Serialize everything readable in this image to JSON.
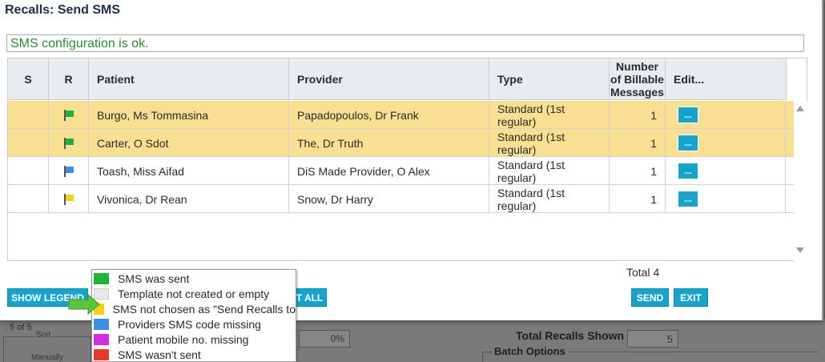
{
  "dialog": {
    "title": "Recalls: Send SMS",
    "status_message": "SMS configuration is ok.",
    "status_color": "#2d8a2d"
  },
  "grid": {
    "columns": {
      "s": "S",
      "r": "R",
      "patient": "Patient",
      "provider": "Provider",
      "type": "Type",
      "billable": [
        "Number",
        "of Billable",
        "Messages"
      ],
      "edit": "Edit..."
    },
    "rows": [
      {
        "flag": "green-flag",
        "flag_color": "#1fb437",
        "patient": "Burgo, Ms Tommasina",
        "provider": "Papadopoulos, Dr Frank",
        "type": [
          "Standard (1st",
          "regular)"
        ],
        "billable": "1",
        "edit": "...",
        "selected": true
      },
      {
        "flag": "green-flag",
        "flag_color": "#1fb437",
        "patient": "Carter, O Sdot",
        "provider": "The, Dr Truth",
        "type": [
          "Standard (1st",
          "regular)"
        ],
        "billable": "1",
        "edit": "...",
        "selected": true
      },
      {
        "flag": "blue-flag",
        "flag_color": "#3d8ee6",
        "patient": "Toash, Miss Aifad",
        "provider": "DiS Made Provider, O Alex",
        "type": [
          "Standard (1st",
          "regular)"
        ],
        "billable": "1",
        "edit": "...",
        "selected": false
      },
      {
        "flag": "yellow-flag",
        "flag_color": "#f2d21a",
        "patient": "Vivonica, Dr Rean",
        "provider": "Snow, Dr Harry",
        "type": [
          "Standard (1st",
          "regular)"
        ],
        "billable": "1",
        "edit": "...",
        "selected": false
      }
    ],
    "selected_row_color": "#f8df92"
  },
  "total": "Total 4",
  "buttons": {
    "show_legend": "SHOW LEGEND",
    "print_all": "T ALL",
    "send": "SEND",
    "exit": "EXIT"
  },
  "legend": {
    "items": [
      {
        "label": "SMS was sent",
        "color": "#1fb437"
      },
      {
        "label": "Template not created or empty",
        "color": "#e8e8e8"
      },
      {
        "label": "SMS not chosen as \"Send Recalls to",
        "color": "#f2d21a"
      },
      {
        "label": "Providers SMS code missing",
        "color": "#3d8ee6"
      },
      {
        "label": "Patient mobile no. missing",
        "color": "#d22ee0"
      },
      {
        "label": "SMS wasn't sent",
        "color": "#e8382e"
      }
    ]
  },
  "background": {
    "pager": ": 5 of 5",
    "sort_label": "Sort",
    "manual_label": "Manually",
    "progress": "0%",
    "total_recalls_label": "Total Recalls Shown",
    "total_recalls_value": "5",
    "batch_options_label": "Batch Options"
  },
  "accent_color": "#17a3cc"
}
